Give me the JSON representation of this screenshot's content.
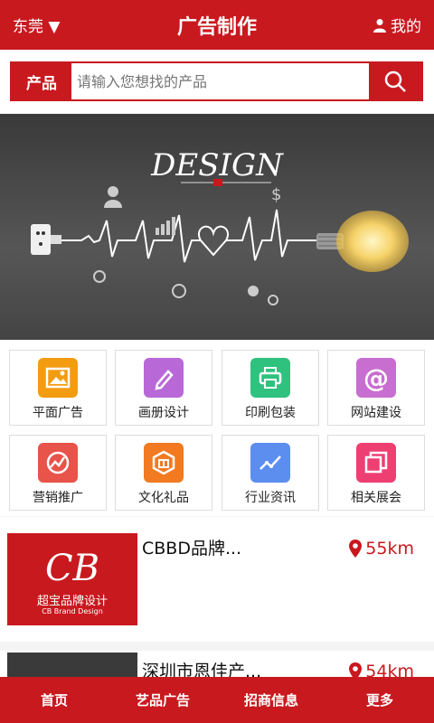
{
  "header": {
    "city": "东莞",
    "title": "广告制作",
    "mine": "我的"
  },
  "search": {
    "category": "产品",
    "placeholder": "请输入您想找的产品"
  },
  "banner": {
    "word": "DESIGN"
  },
  "categories": [
    {
      "label": "平面广告",
      "icon": "image-icon",
      "color": "#f39c12"
    },
    {
      "label": "画册设计",
      "icon": "pencil-icon",
      "color": "#b968d8"
    },
    {
      "label": "印刷包装",
      "icon": "printer-icon",
      "color": "#2ec27e"
    },
    {
      "label": "网站建设",
      "icon": "at-icon",
      "color": "#c86ed0"
    },
    {
      "label": "营销推广",
      "icon": "trend-icon",
      "color": "#e8534a"
    },
    {
      "label": "文化礼品",
      "icon": "gift-icon",
      "color": "#f27a21"
    },
    {
      "label": "行业资讯",
      "icon": "chart-icon",
      "color": "#5c8ef0"
    },
    {
      "label": "相关展会",
      "icon": "layers-icon",
      "color": "#ee3f73"
    }
  ],
  "listings": [
    {
      "name": "CBBD品牌...",
      "distance": "55km",
      "logo_main": "CB",
      "logo_sub": "超宝品牌设计",
      "logo_en": "CB Brand Design"
    },
    {
      "name": "深圳市恩佳产...",
      "distance": "54km"
    }
  ],
  "nav": [
    "首页",
    "艺品广告",
    "招商信息",
    "更多"
  ],
  "colors": {
    "brand": "#c8191f"
  }
}
